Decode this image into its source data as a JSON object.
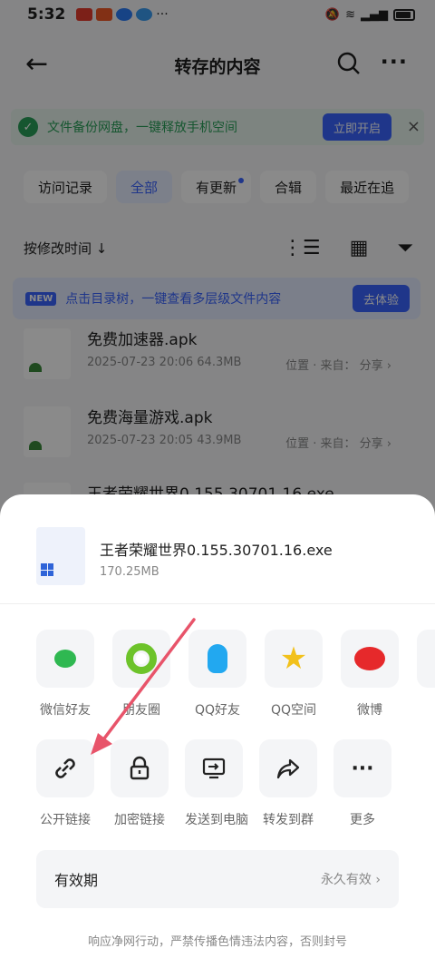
{
  "status_bar": {
    "time": "5:32",
    "app_icon_colors": [
      "#e63b2e",
      "#f05a28",
      "#2b7cf6",
      "#3a9cf0"
    ],
    "more": "···"
  },
  "header": {
    "title": "转存的内容"
  },
  "banner": {
    "text": "文件备份网盘，一键释放手机空间",
    "button": "立即开启",
    "close": "×"
  },
  "filters": [
    {
      "label": "访问记录",
      "active": false
    },
    {
      "label": "全部",
      "active": true
    },
    {
      "label": "有更新",
      "active": false,
      "dot": true
    },
    {
      "label": "合辑",
      "active": false
    },
    {
      "label": "最近在追",
      "active": false
    }
  ],
  "sort": {
    "label": "按修改时间 ↓"
  },
  "tip": {
    "badge": "NEW",
    "text": "点击目录树，一键查看多层级文件内容",
    "button": "去体验"
  },
  "files": [
    {
      "name": "免费加速器.apk",
      "meta": "2025-07-23 20:06  64.3MB",
      "location": "位置 · 来自： 分享 ›"
    },
    {
      "name": "免费海量游戏.apk",
      "meta": "2025-07-23 20:05  43.9MB",
      "location": "位置 · 来自： 分享 ›"
    },
    {
      "name": "王者荣耀世界0.155.30701.16.exe",
      "meta": "",
      "location": ""
    }
  ],
  "sheet": {
    "file_name": "王者荣耀世界0.155.30701.16.exe",
    "file_size": "170.25MB",
    "share_row_1": [
      {
        "label": "微信好友",
        "icon": "wechat-icon"
      },
      {
        "label": "朋友圈",
        "icon": "moments-icon"
      },
      {
        "label": "QQ好友",
        "icon": "qq-icon"
      },
      {
        "label": "QQ空间",
        "icon": "qzone-icon"
      },
      {
        "label": "微博",
        "icon": "weibo-icon"
      }
    ],
    "share_row_2": [
      {
        "label": "公开链接",
        "icon": "link-icon"
      },
      {
        "label": "加密链接",
        "icon": "lock-icon"
      },
      {
        "label": "发送到电脑",
        "icon": "send-to-pc-icon"
      },
      {
        "label": "转发到群",
        "icon": "forward-icon"
      },
      {
        "label": "更多",
        "icon": "more-icon"
      }
    ],
    "validity_label": "有效期",
    "validity_value": "永久有效 ›",
    "footer": "响应净网行动，严禁传播色情违法内容，否则封号"
  },
  "colors": {
    "accent": "#3a64ff",
    "annotation_arrow": "#e8546a"
  }
}
